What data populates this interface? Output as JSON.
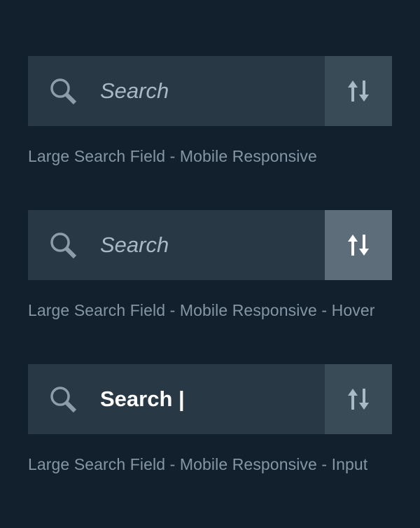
{
  "variants": [
    {
      "state": "default",
      "search_text": "Search",
      "caption": "Large Search Field - Mobile Responsive",
      "icon": "magnifier-icon",
      "sort_icon": "sort-arrows-icon"
    },
    {
      "state": "hover",
      "search_text": "Search",
      "caption": "Large Search Field - Mobile Responsive - Hover",
      "icon": "magnifier-icon",
      "sort_icon": "sort-arrows-icon"
    },
    {
      "state": "input",
      "search_text": "Search |",
      "caption": "Large Search Field - Mobile Responsive - Input",
      "icon": "magnifier-icon",
      "sort_icon": "sort-arrows-icon"
    }
  ],
  "colors": {
    "background": "#12202e",
    "field": "#283845",
    "sort_button": "#394b57",
    "sort_button_hover": "#5d6d79",
    "placeholder": "#a9bac6",
    "input_text": "#ffffff",
    "caption": "#8596a2"
  }
}
